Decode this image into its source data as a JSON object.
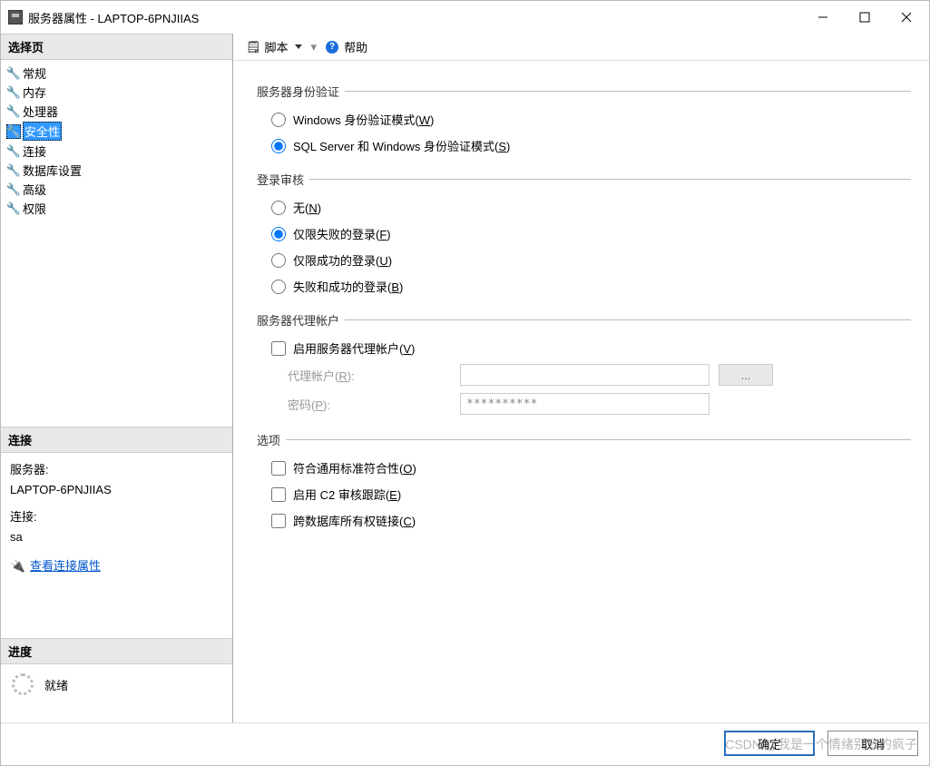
{
  "window": {
    "title": "服务器属性 - LAPTOP-6PNJIIAS"
  },
  "toolbar": {
    "script_label": "脚本",
    "help_label": "帮助"
  },
  "sidebar": {
    "select_page_header": "选择页",
    "items": [
      {
        "label": "常规"
      },
      {
        "label": "内存"
      },
      {
        "label": "处理器"
      },
      {
        "label": "安全性"
      },
      {
        "label": "连接"
      },
      {
        "label": "数据库设置"
      },
      {
        "label": "高级"
      },
      {
        "label": "权限"
      }
    ],
    "connection_header": "连接",
    "server_label": "服务器:",
    "server_value": "LAPTOP-6PNJIIAS",
    "connection_label": "连接:",
    "connection_value": "sa",
    "view_conn_props": "查看连接属性",
    "progress_header": "进度",
    "progress_status": "就绪"
  },
  "main": {
    "auth": {
      "legend": "服务器身份验证",
      "windows_label": "Windows 身份验证模式(",
      "windows_mnem": "W",
      "mixed_label": "SQL Server 和 Windows 身份验证模式(",
      "mixed_mnem": "S",
      "close": ")"
    },
    "audit": {
      "legend": "登录审核",
      "none_label": "无(",
      "none_mnem": "N",
      "failed_label": "仅限失败的登录(",
      "failed_mnem": "F",
      "success_label": "仅限成功的登录(",
      "success_mnem": "U",
      "both_label": "失败和成功的登录(",
      "both_mnem": "B",
      "close": ")"
    },
    "proxy": {
      "legend": "服务器代理帐户",
      "enable_label": "启用服务器代理帐户(",
      "enable_mnem": "V",
      "close": ")",
      "account_label_pre": "代理帐户(",
      "account_mnem": "R",
      "account_label_post": "):",
      "password_label_pre": "密码(",
      "password_mnem": "P",
      "password_label_post": "):",
      "password_value": "**********",
      "browse_label": "..."
    },
    "options": {
      "legend": "选项",
      "common_label": "符合通用标准符合性(",
      "common_mnem": "O",
      "c2_label": "启用 C2 审核跟踪(",
      "c2_mnem": "E",
      "cross_label": "跨数据库所有权链接(",
      "cross_mnem": "C",
      "close": ")"
    }
  },
  "footer": {
    "ok": "确定",
    "cancel": "取消"
  },
  "watermark": "CSDN @我是一个情绪别致的疯子"
}
